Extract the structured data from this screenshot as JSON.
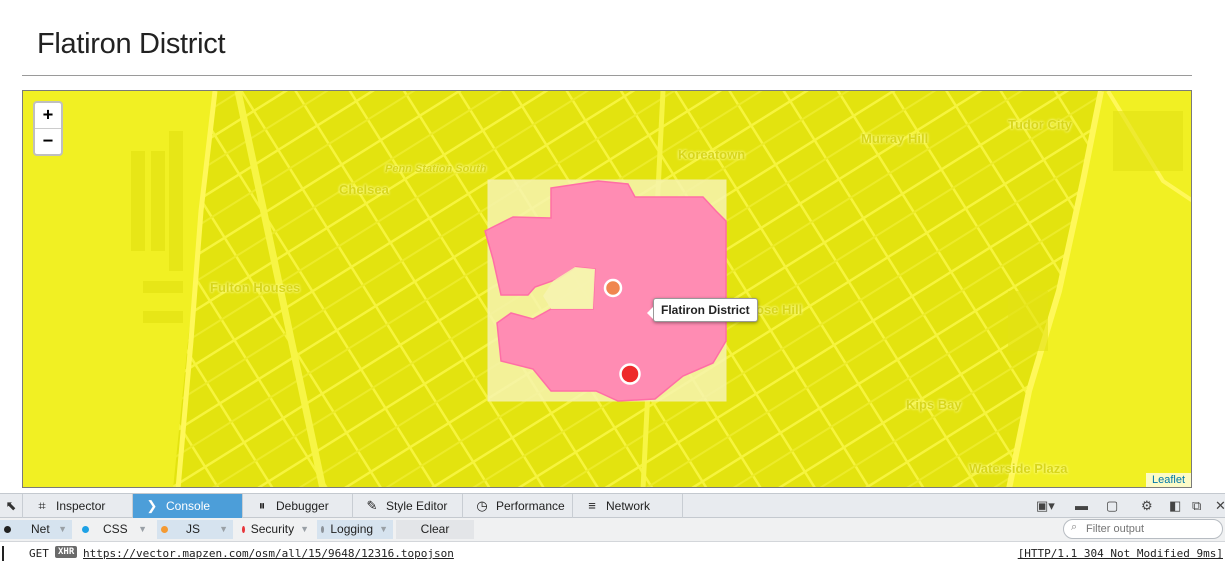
{
  "page": {
    "title": "Flatiron District"
  },
  "map": {
    "zoom_in": "+",
    "zoom_out": "−",
    "labels": [
      {
        "text": "Koreatown"
      },
      {
        "text": "Murray Hill"
      },
      {
        "text": "Tudor City"
      },
      {
        "text": "Penn Station South"
      },
      {
        "text": "Chelsea"
      },
      {
        "text": "Fulton Houses"
      },
      {
        "text": "ose Hill"
      },
      {
        "text": "Kips Bay"
      },
      {
        "text": "Waterside Plaza"
      }
    ],
    "tooltip": "Flatiron District",
    "attribution": "Leaflet",
    "colors": {
      "overlay": "#f1f023",
      "polygon": "#ff86b4",
      "bbox": "#f6f3b0",
      "marker_center": "#f08650",
      "marker_point": "#ee2a2a"
    }
  },
  "devtools": {
    "picker_icon": "cursor-pick-icon",
    "tabs": [
      {
        "label": "Inspector",
        "icon": "inspector-icon",
        "active": false
      },
      {
        "label": "Console",
        "icon": "console-icon",
        "active": true
      },
      {
        "label": "Debugger",
        "icon": "debugger-icon",
        "active": false
      },
      {
        "label": "Style Editor",
        "icon": "style-editor-icon",
        "active": false
      },
      {
        "label": "Performance",
        "icon": "performance-icon",
        "active": false
      },
      {
        "label": "Network",
        "icon": "network-icon",
        "active": false
      }
    ],
    "filters": [
      {
        "label": "Net",
        "color": "#222222",
        "on": true
      },
      {
        "label": "CSS",
        "color": "#1da1e5",
        "on": false
      },
      {
        "label": "JS",
        "color": "#f49a33",
        "on": true
      },
      {
        "label": "Security",
        "color": "#e8363b",
        "on": false
      },
      {
        "label": "Logging",
        "color": "#8d939a",
        "on": true
      }
    ],
    "clear_label": "Clear",
    "filter_placeholder": "Filter output",
    "log": {
      "method": "GET",
      "badge": "XHR",
      "url": "https://vector.mapzen.com/osm/all/15/9648/12316.topojson",
      "status": "[HTTP/1.1 304 Not Modified 9ms]"
    }
  }
}
